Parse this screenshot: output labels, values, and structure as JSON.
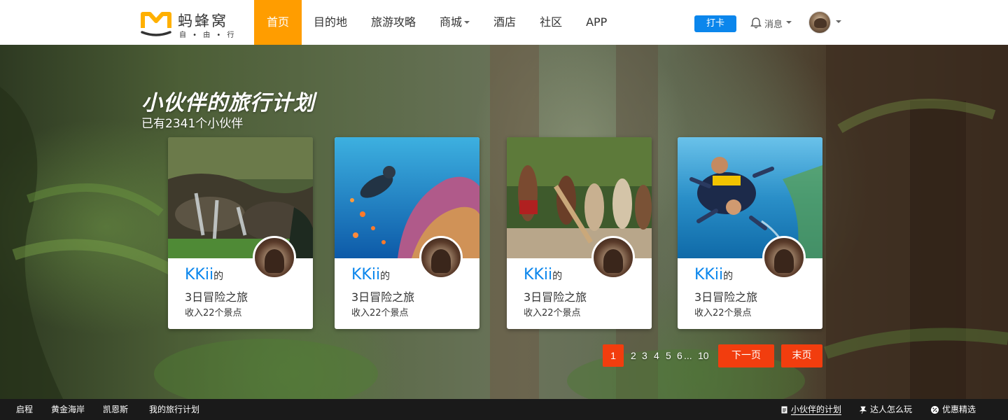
{
  "brand": {
    "name": "蚂蜂窝",
    "slogan": "自 • 由 • 行"
  },
  "nav": {
    "items": [
      {
        "label": "首页",
        "active": true
      },
      {
        "label": "目的地"
      },
      {
        "label": "旅游攻略"
      },
      {
        "label": "商城",
        "dropdown": true
      },
      {
        "label": "酒店"
      },
      {
        "label": "社区"
      },
      {
        "label": "APP"
      }
    ],
    "checkin_label": "打卡",
    "messages_label": "消息"
  },
  "hero": {
    "title": "小伙伴的旅行计划",
    "count_text": "已有2341个小伙伴"
  },
  "cards": [
    {
      "user": "KKii",
      "suffix": "的",
      "trip": "3日冒险之旅",
      "spots": "收入22个景点",
      "image": "waterfall-stream"
    },
    {
      "user": "KKii",
      "suffix": "的",
      "trip": "3日冒险之旅",
      "spots": "收入22个景点",
      "image": "scuba-diver-reef"
    },
    {
      "user": "KKii",
      "suffix": "的",
      "trip": "3日冒险之旅",
      "spots": "收入22个景点",
      "image": "tribal-dancers"
    },
    {
      "user": "KKii",
      "suffix": "的",
      "trip": "3日冒险之旅",
      "spots": "收入22个景点",
      "image": "skydiving-coast"
    }
  ],
  "pagination": {
    "current": "1",
    "pages": [
      "2",
      "3",
      "4",
      "5",
      "6"
    ],
    "ellipsis": "...",
    "last_page": "10",
    "next_label": "下一页",
    "end_label": "末页"
  },
  "footer": {
    "links": [
      "启程",
      "黄金海岸",
      "凯恩斯",
      "我的旅行计划"
    ],
    "right": [
      {
        "label": "小伙伴的计划",
        "icon": "document-icon",
        "active": true
      },
      {
        "label": "达人怎么玩",
        "icon": "pin-icon"
      },
      {
        "label": "优惠精选",
        "icon": "discount-icon"
      }
    ]
  },
  "colors": {
    "accent": "#ff9d00",
    "primary_blue": "#0b86ec",
    "pager_red": "#f23d0e",
    "footer_bg": "#1a1a1a"
  }
}
